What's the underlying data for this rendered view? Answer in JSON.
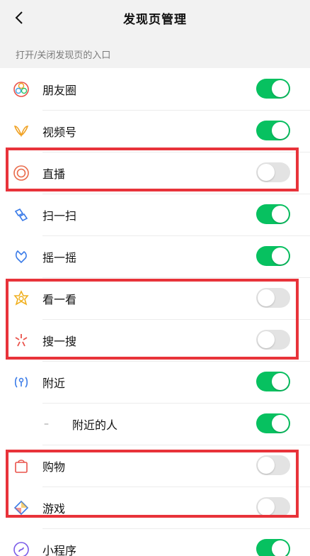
{
  "header": {
    "title": "发现页管理"
  },
  "section_label": "打开/关闭发现页的入口",
  "items": [
    {
      "label": "朋友圈",
      "on": true
    },
    {
      "label": "视频号",
      "on": true
    },
    {
      "label": "直播",
      "on": false
    },
    {
      "label": "扫一扫",
      "on": true
    },
    {
      "label": "摇一摇",
      "on": true
    },
    {
      "label": "看一看",
      "on": false
    },
    {
      "label": "搜一搜",
      "on": false
    },
    {
      "label": "附近",
      "on": true
    },
    {
      "label": "附近的人",
      "on": true
    },
    {
      "label": "购物",
      "on": false
    },
    {
      "label": "游戏",
      "on": false
    },
    {
      "label": "小程序",
      "on": true
    }
  ],
  "colors": {
    "toggle_on": "#07c160",
    "toggle_off": "#e3e3e3",
    "highlight": "#e8333a"
  }
}
